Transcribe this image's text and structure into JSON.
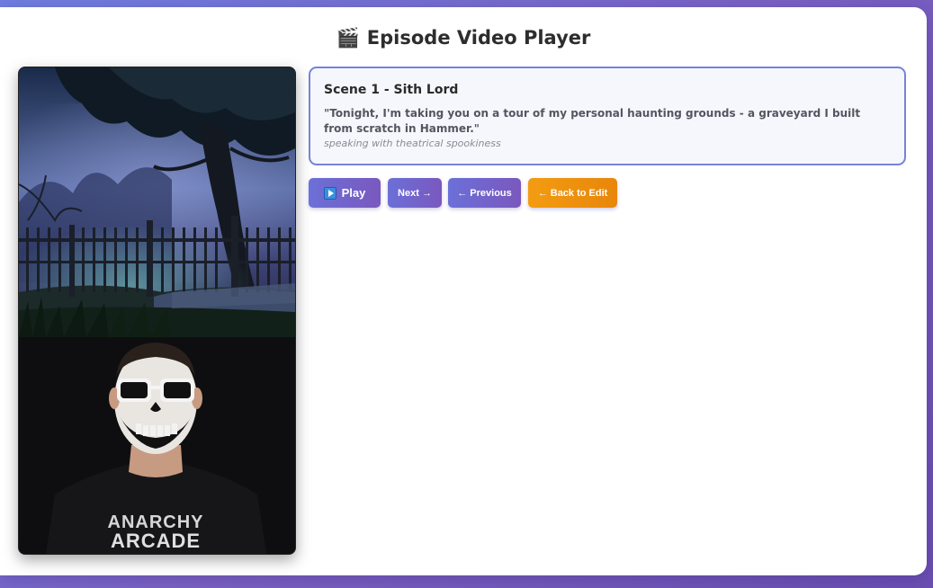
{
  "page": {
    "title": "Episode Video Player",
    "title_icon": "clapperboard-icon"
  },
  "video": {
    "top_image": "graveyard-scene-image",
    "bottom_image": "skull-facepaint-presenter-image",
    "shirt_text": "ANARCHY ARCADE"
  },
  "scene": {
    "title": "Scene 1 - Sith Lord",
    "quote": "\"Tonight, I'm taking you on a tour of my personal haunting grounds - a graveyard I built from scratch in Hammer.\"",
    "direction": "speaking with theatrical spookiness"
  },
  "controls": {
    "play_label": "Play",
    "next_label": "Next →",
    "previous_label": "← Previous",
    "back_label": "← Back to Edit"
  },
  "colors": {
    "accent": "#7176d6",
    "back_button": "#f0950f",
    "background_gradient_start": "#6f7fe0",
    "background_gradient_end": "#6b4fb3"
  }
}
